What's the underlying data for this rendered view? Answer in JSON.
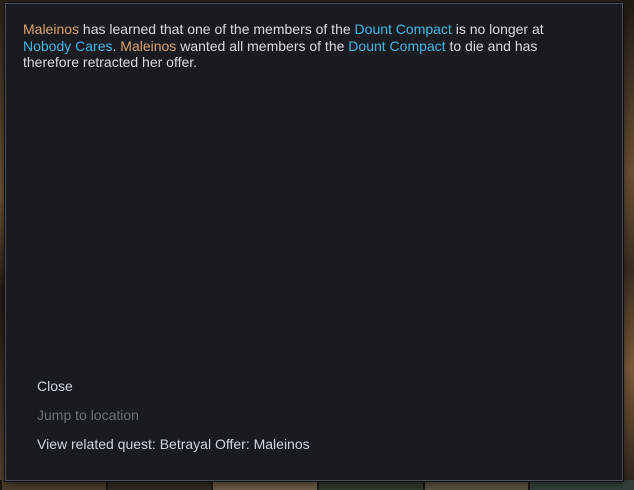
{
  "message": {
    "part1_name": "Maleinos",
    "part2": " has learned that one of the members of the ",
    "part3_faction": "Dount Compact",
    "part4": " is no longer at ",
    "part5_faction": "Nobody Cares",
    "part6": ". ",
    "part7_name": "Maleinos",
    "part8": " wanted all members of the ",
    "part9_faction": "Dount Compact",
    "part10": " to die and has therefore retracted her offer."
  },
  "actions": {
    "close_label": "Close",
    "jump_label": "Jump to location",
    "quest_label": "View related quest: Betrayal Offer: Maleinos"
  },
  "colors": {
    "person": "#e0a26a",
    "faction": "#3fb6e8",
    "text": "#d7dbe0",
    "disabled": "#6c7178",
    "panel": "#181b20"
  }
}
